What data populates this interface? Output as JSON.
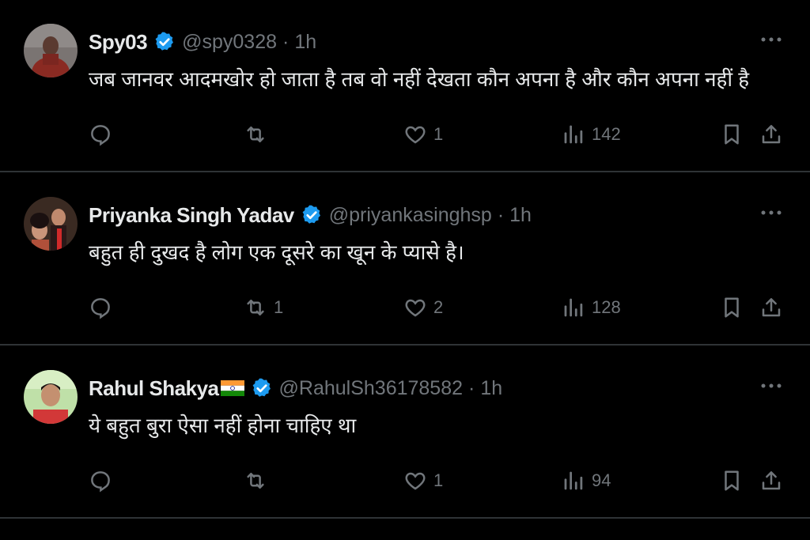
{
  "colors": {
    "background": "#000000",
    "text": "#e7e9ea",
    "muted": "#71767b",
    "verified": "#1d9bf0",
    "divider": "#2f3336"
  },
  "tweets": [
    {
      "name": "Spy03",
      "handle": "@spy0328",
      "separator": "·",
      "time": "1h",
      "text": "जब जानवर आदमखोर हो जाता है तब वो नहीं देखता कौन अपना है और कौन अपना नहीं है",
      "reply_count": "",
      "retweet_count": "",
      "like_count": "1",
      "view_count": "142",
      "icons": [
        "reply-icon",
        "retweet-icon",
        "like-icon",
        "views-icon",
        "bookmark-icon",
        "share-icon"
      ]
    },
    {
      "name": "Priyanka Singh Yadav",
      "handle": "@priyankasinghsp",
      "separator": "·",
      "time": "1h",
      "text": "बहुत ही दुखद है लोग एक दूसरे का खून के प्यासे है।",
      "reply_count": "",
      "retweet_count": "1",
      "like_count": "2",
      "view_count": "128"
    },
    {
      "name": "Rahul Shakya",
      "has_flag": true,
      "handle": "@RahulSh36178582",
      "separator": "·",
      "time": "1h",
      "text": "ये बहुत बुरा ऐसा नहीं होना चाहिए था",
      "reply_count": "",
      "retweet_count": "",
      "like_count": "1",
      "view_count": "94"
    }
  ]
}
